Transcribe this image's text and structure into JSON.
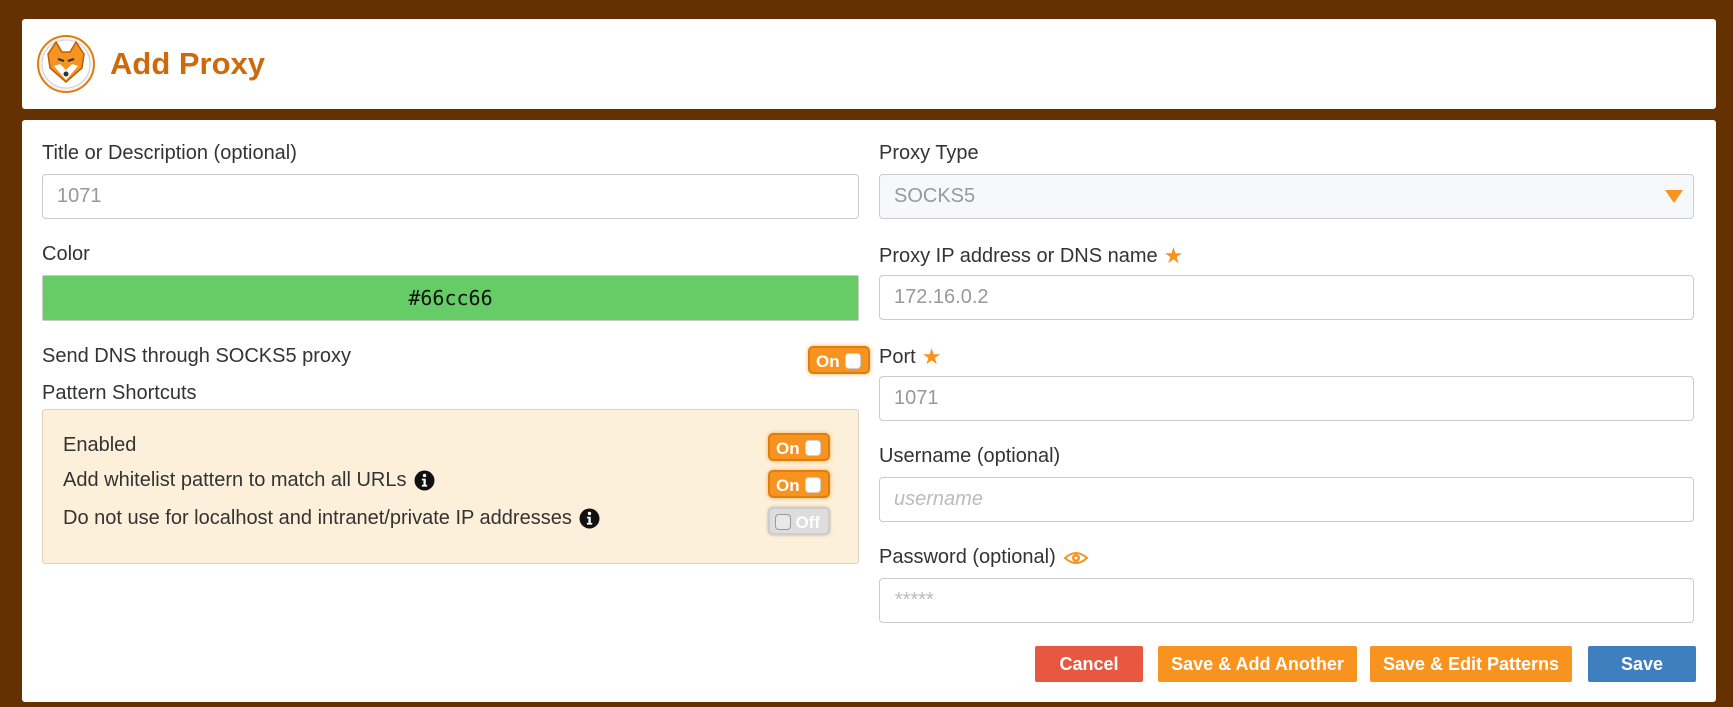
{
  "header": {
    "title": "Add Proxy",
    "logo_icon": "foxyproxy-logo"
  },
  "left": {
    "title_label": "Title or Description (optional)",
    "title_value": "1071",
    "color_label": "Color",
    "color_value": "#66cc66",
    "send_dns_label": "Send DNS through SOCKS5 proxy",
    "send_dns_toggle": "On",
    "pattern_shortcuts_label": "Pattern Shortcuts",
    "shortcuts": [
      {
        "label": "Enabled",
        "toggle": "On",
        "has_info": false
      },
      {
        "label": "Add whitelist pattern to match all URLs",
        "toggle": "On",
        "has_info": true
      },
      {
        "label": "Do not use for localhost and intranet/private IP addresses",
        "toggle": "Off",
        "has_info": true
      }
    ]
  },
  "right": {
    "proxy_type_label": "Proxy Type",
    "proxy_type_value": "SOCKS5",
    "ip_label": "Proxy IP address or DNS name",
    "ip_value": "172.16.0.2",
    "port_label": "Port",
    "port_value": "1071",
    "username_label": "Username (optional)",
    "username_placeholder": "username",
    "password_label": "Password (optional)",
    "password_placeholder": "*****"
  },
  "buttons": {
    "cancel": "Cancel",
    "save_add_another": "Save & Add Another",
    "save_edit_patterns": "Save & Edit Patterns",
    "save": "Save"
  },
  "colors": {
    "background": "#653100",
    "accent": "#f7931e",
    "title": "#cc6a0e",
    "cancel": "#e8573f",
    "save": "#3f7fbf",
    "shortcut_box": "#fdf0db"
  }
}
